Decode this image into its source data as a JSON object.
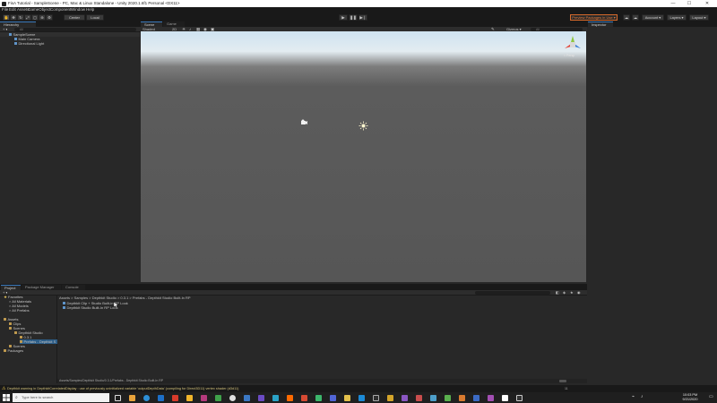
{
  "window": {
    "title": "FisA Tutorial - SampleScene - PC, Mac & Linux Standalone - Unity 2020.1.6f1 Personal <DX11>",
    "controls": [
      "—",
      "☐",
      "✕"
    ]
  },
  "menu": [
    "File",
    "Edit",
    "Assets",
    "GameObject",
    "Component",
    "Window",
    "Help"
  ],
  "toolbar": {
    "pivot_label": "Center",
    "space_label": "Local",
    "preview_packages": "Preview Packages in Use ▾",
    "account_label": "Account ▾",
    "layers_label": "Layers ▾",
    "layout_label": "Layout ▾"
  },
  "hierarchy": {
    "tab": "Hierarchy",
    "add_label": "+ ▾",
    "search_placeholder": "All",
    "scene": "SampleScene",
    "items": [
      "Main Camera",
      "Directional Light"
    ]
  },
  "scene_view": {
    "tabs": [
      "Scene",
      "Game"
    ],
    "shading": "Shaded",
    "mode_2d": "2D",
    "gizmos": "Gizmos ▾",
    "search_placeholder": "All",
    "persp_label": "< Persp"
  },
  "inspector": {
    "tab": "Inspector"
  },
  "project": {
    "tabs": [
      "Project",
      "Package Manager",
      "Console"
    ],
    "add_label": "+ ▾",
    "favorites": {
      "label": "Favorites",
      "items": [
        "All Materials",
        "All Models",
        "All Prefabs"
      ]
    },
    "assets": {
      "label": "Assets",
      "items": [
        "Clips",
        "Scenes"
      ],
      "depthkit_studio": "Depthkit Studio",
      "version": "0.3.1",
      "prefabs": "Prefabs - Depthkit S",
      "scenes": "Scenes"
    },
    "packages_label": "Packages",
    "breadcrumb": [
      "Assets",
      "Samples",
      "Depthkit Studio",
      "0.3.1",
      "Prefabs - Depthkit Studio Built-In RP"
    ],
    "files": [
      "Depthkit Clip + Studio Built-in RP Look",
      "Depthkit Studio Built-In RP Look"
    ],
    "status_path": "Assets/Samples/Depthkit Studio/0.3.1/Prefabs - Depthkit Studio Built-In RP",
    "badge_count": "11"
  },
  "status_bar": {
    "message": "Depthkit warning in DepthkitCorrelatedDisplay : use of previously uninitialized variable 'outputDepthData' (compiling for Direct3D11) vertex shader (d3d11)"
  },
  "taskbar": {
    "search_placeholder": "Type here to search",
    "time": "10:03 PM",
    "date": "9/21/2020"
  },
  "colors": {
    "accent_orange": "#e87b3a",
    "selection_blue": "#2c5d87",
    "warning_yellow": "#e5c248"
  }
}
